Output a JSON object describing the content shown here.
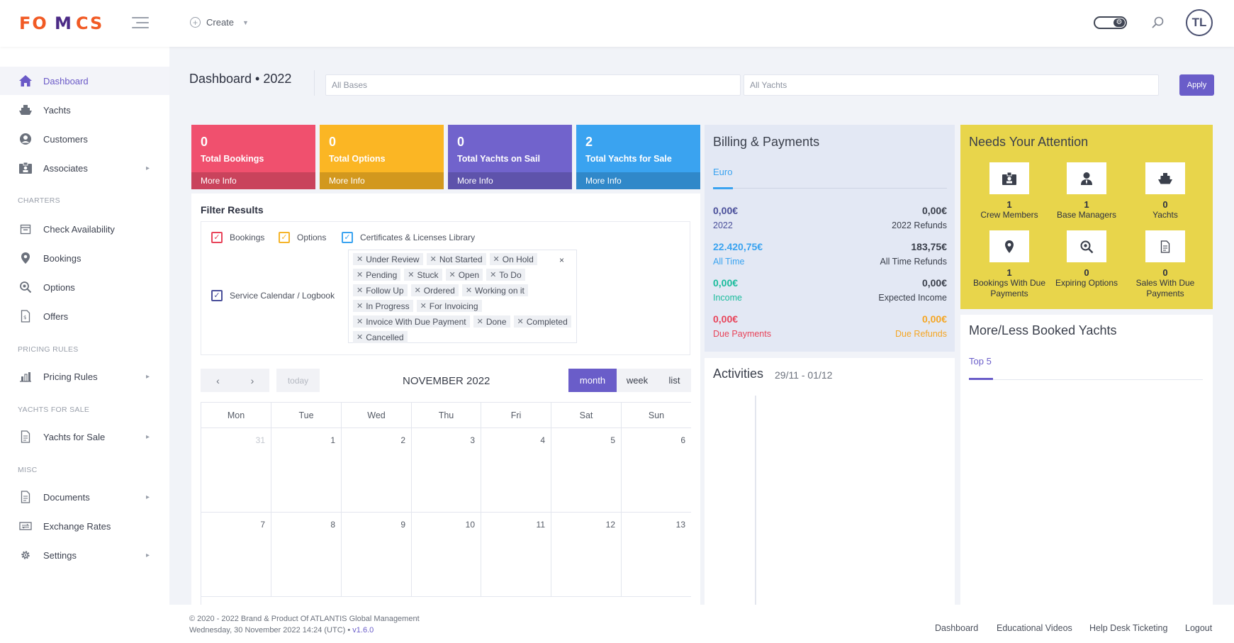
{
  "app": {
    "logo_text": "FOMCS",
    "user_initials": "TL"
  },
  "header": {
    "create_label": "Create"
  },
  "colors": {
    "accent": "#6a5dc9",
    "logo_orange": "#f15a24",
    "logo_purple": "#4b2a86",
    "pink": "#f0506e",
    "amber": "#fbb624",
    "purple": "#7163cc",
    "blue": "#3aa3f0",
    "yellow": "#e8d54b",
    "green": "#1abc9c",
    "red": "#e8445a",
    "orange": "#f5a623"
  },
  "sidebar": {
    "items": [
      {
        "label": "Dashboard",
        "icon": "home-icon",
        "active": true
      },
      {
        "label": "Yachts",
        "icon": "ship-icon"
      },
      {
        "label": "Customers",
        "icon": "user-circle-icon"
      },
      {
        "label": "Associates",
        "icon": "id-badge-icon",
        "has_children": true
      }
    ],
    "sections": [
      {
        "title": "CHARTERS",
        "items": [
          {
            "label": "Check Availability",
            "icon": "calendar-icon"
          },
          {
            "label": "Bookings",
            "icon": "map-pin-icon"
          },
          {
            "label": "Options",
            "icon": "magnifier-icon"
          },
          {
            "label": "Offers",
            "icon": "file-icon"
          }
        ]
      },
      {
        "title": "PRICING RULES",
        "items": [
          {
            "label": "Pricing Rules",
            "icon": "chart-icon",
            "has_children": true
          }
        ]
      },
      {
        "title": "YACHTS FOR SALE",
        "items": [
          {
            "label": "Yachts for Sale",
            "icon": "document-icon",
            "has_children": true
          }
        ]
      },
      {
        "title": "MISC",
        "items": [
          {
            "label": "Documents",
            "icon": "document-icon",
            "has_children": true
          },
          {
            "label": "Exchange Rates",
            "icon": "exchange-icon"
          },
          {
            "label": "Settings",
            "icon": "gear-icon",
            "has_children": true
          }
        ]
      }
    ]
  },
  "page": {
    "title": "Dashboard • 2022",
    "bases_placeholder": "All Bases",
    "yachts_placeholder": "All Yachts",
    "apply_label": "Apply"
  },
  "stats": [
    {
      "value": "0",
      "label": "Total Bookings",
      "more": "More Info",
      "color": "#f0506e"
    },
    {
      "value": "0",
      "label": "Total Options",
      "more": "More Info",
      "color": "#fbb624"
    },
    {
      "value": "0",
      "label": "Total Yachts on Sail",
      "more": "More Info",
      "color": "#7163cc"
    },
    {
      "value": "2",
      "label": "Total Yachts for Sale",
      "more": "More Info",
      "color": "#3aa3f0"
    }
  ],
  "filter": {
    "title": "Filter Results",
    "checks": [
      {
        "label": "Bookings",
        "color": "#e8445a"
      },
      {
        "label": "Options",
        "color": "#f5b42a"
      },
      {
        "label": "Certificates & Licenses Library",
        "color": "#3aa3f0"
      },
      {
        "label": "Service Calendar / Logbook",
        "color": "#4a4f9a"
      }
    ],
    "tags": [
      "Under Review",
      "Not Started",
      "On Hold",
      "Pending",
      "Stuck",
      "Open",
      "To Do",
      "Follow Up",
      "Ordered",
      "Working on it",
      "In Progress",
      "For Invoicing",
      "Invoice With Due Payment",
      "Done",
      "Completed",
      "Cancelled"
    ],
    "clear": "×"
  },
  "calendar": {
    "title": "NOVEMBER 2022",
    "today": "today",
    "prev": "‹",
    "next": "›",
    "views": [
      "month",
      "week",
      "list"
    ],
    "weekdays": [
      "Mon",
      "Tue",
      "Wed",
      "Thu",
      "Fri",
      "Sat",
      "Sun"
    ],
    "weeks": [
      [
        "31",
        "1",
        "2",
        "3",
        "4",
        "5",
        "6"
      ],
      [
        "7",
        "8",
        "9",
        "10",
        "11",
        "12",
        "13"
      ]
    ]
  },
  "billing": {
    "title": "Billing & Payments",
    "tab": "Euro",
    "rows": [
      {
        "left_value": "0,00€",
        "left_label": "2022",
        "right_value": "0,00€",
        "right_label": "2022 Refunds"
      },
      {
        "left_value": "22.420,75€",
        "left_label": "All Time",
        "right_value": "183,75€",
        "right_label": "All Time Refunds"
      },
      {
        "left_value": "0,00€",
        "left_label": "Income",
        "right_value": "0,00€",
        "right_label": "Expected Income"
      },
      {
        "left_value": "0,00€",
        "left_label": "Due Payments",
        "right_value": "0,00€",
        "right_label": "Due Refunds"
      }
    ]
  },
  "attention": {
    "title": "Needs Your Attention",
    "items": [
      {
        "count": "1",
        "label": "Crew Members",
        "icon": "id-badge-icon"
      },
      {
        "count": "1",
        "label": "Base Managers",
        "icon": "user-icon"
      },
      {
        "count": "0",
        "label": "Yachts",
        "icon": "ship-icon"
      },
      {
        "count": "1",
        "label": "Bookings With Due Payments",
        "icon": "map-pin-icon"
      },
      {
        "count": "0",
        "label": "Expiring Options",
        "icon": "magnifier-icon"
      },
      {
        "count": "0",
        "label": "Sales With Due Payments",
        "icon": "document-icon"
      }
    ]
  },
  "activities": {
    "title": "Activities",
    "range": "29/11 - 01/12"
  },
  "booked": {
    "title": "More/Less Booked Yachts",
    "tab": "Top 5"
  },
  "footer": {
    "copyright": "© 2020 - 2022 Brand & Product Of ATLANTIS Global Management",
    "datetime": "Wednesday, 30 November 2022 14:24 (UTC) •",
    "version": "v1.6.0",
    "links": [
      "Dashboard",
      "Educational Videos",
      "Help Desk Ticketing",
      "Logout"
    ]
  }
}
